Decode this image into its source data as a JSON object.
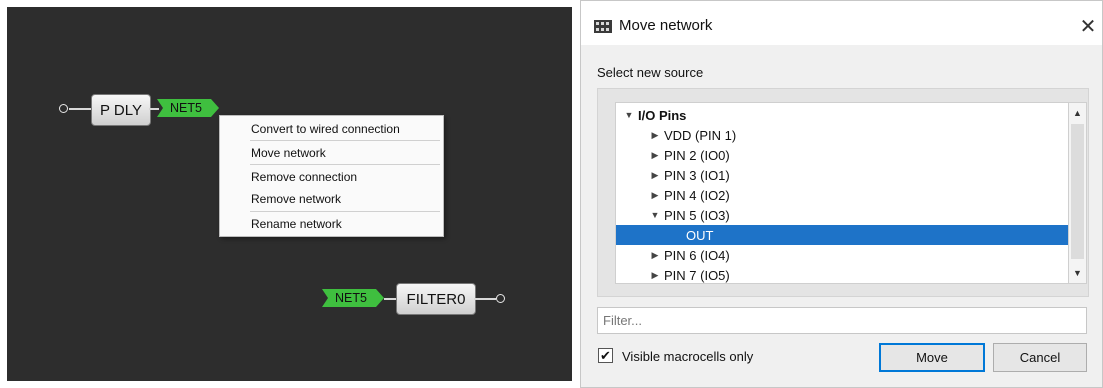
{
  "canvas": {
    "block_pdly": "P DLY",
    "block_filter": "FILTER0",
    "net_out_label": "NET5",
    "net_in_label": "NET5",
    "net_color": "#3fbf3f"
  },
  "context_menu": {
    "items": [
      "Convert to wired connection",
      "Move network",
      "Remove connection",
      "Remove network",
      "Rename network"
    ]
  },
  "dialog": {
    "title": "Move network",
    "close_glyph": "✕",
    "icon": "chip-icon",
    "select_label": "Select new source",
    "tree": [
      {
        "label": "I/O Pins",
        "expanded": true,
        "bold": true
      },
      {
        "label": "VDD (PIN 1)",
        "expanded": false
      },
      {
        "label": "PIN 2 (IO0)",
        "expanded": false
      },
      {
        "label": "PIN 3 (IO1)",
        "expanded": false
      },
      {
        "label": "PIN 4 (IO2)",
        "expanded": false
      },
      {
        "label": "PIN 5 (IO3)",
        "expanded": true
      },
      {
        "label": "OUT",
        "selected": true
      },
      {
        "label": "PIN 6 (IO4)",
        "expanded": false
      },
      {
        "label": "PIN 7 (IO5)",
        "expanded": false
      }
    ],
    "filter_placeholder": "Filter...",
    "visible_checkbox_label": "Visible macrocells only",
    "visible_checked": true,
    "move_label": "Move",
    "cancel_label": "Cancel",
    "selection_color": "#1e73c8"
  }
}
